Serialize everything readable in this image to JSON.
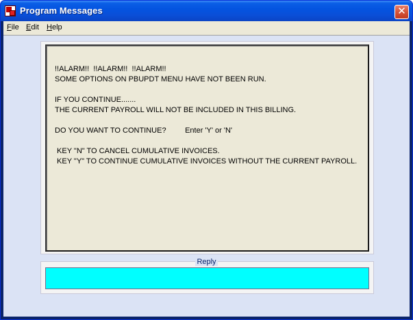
{
  "window": {
    "title": "Program Messages",
    "close_glyph": "✕"
  },
  "menu": {
    "file": {
      "accel": "F",
      "rest": "ile"
    },
    "edit": {
      "accel": "E",
      "rest": "dit"
    },
    "help": {
      "accel": "H",
      "rest": "elp"
    }
  },
  "message": {
    "lines": [
      "!!ALARM!!  !!ALARM!!  !!ALARM!!",
      "SOME OPTIONS ON PBUPDT MENU HAVE NOT BEEN RUN.",
      "IF YOU CONTINUE.......",
      "THE CURRENT PAYROLL WILL NOT BE INCLUDED IN THIS BILLING.",
      "DO YOU WANT TO CONTINUE?         Enter 'Y' or 'N'",
      " KEY \"N\" TO CANCEL CUMULATIVE INVOICES.",
      " KEY \"Y\" TO CONTINUE CUMULATIVE INVOICES WITHOUT THE CURRENT PAYROLL."
    ]
  },
  "reply": {
    "label": "Reply",
    "value": ""
  },
  "colors": {
    "reply_field": "#00ffff",
    "message_bg": "#ece9d8",
    "client_bg": "#dbe3f5"
  }
}
